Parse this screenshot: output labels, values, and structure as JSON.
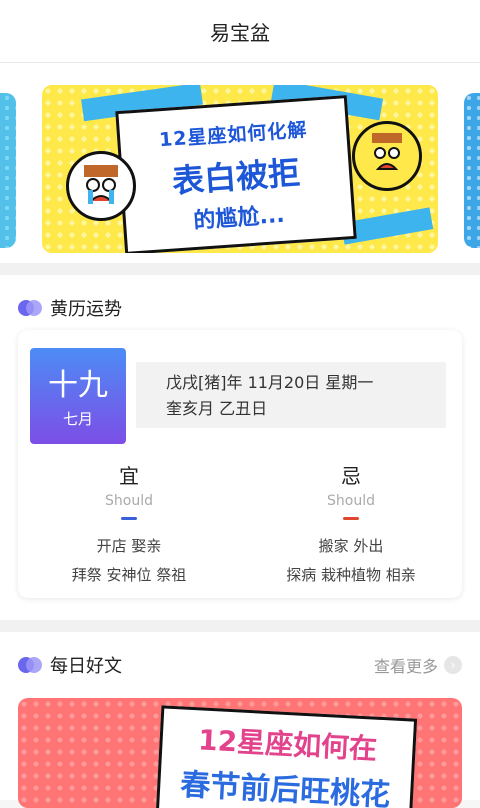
{
  "header": {
    "title": "易宝盆"
  },
  "banner": {
    "line1": "12星座如何化解",
    "line2": "表白被拒",
    "line3": "的尴尬..."
  },
  "almanac": {
    "section_title": "黄历运势",
    "day": "十九",
    "month": "七月",
    "date_line1": "戊戌[猪]年  11月20日  星期一",
    "date_line2": "奎亥月 乙丑日",
    "yi": {
      "title": "宜",
      "sub": "Should",
      "row1": "开店  娶亲",
      "row2": "拜祭  安神位  祭祖",
      "color": "#3a5fd9"
    },
    "ji": {
      "title": "忌",
      "sub": "Should",
      "row1": "搬家  外出",
      "row2": "探病  栽种植物  相亲",
      "color": "#e2452f"
    }
  },
  "articles": {
    "section_title": "每日好文",
    "more_label": "查看更多",
    "banner_line1": "12星座如何在",
    "banner_line2": "春节前后旺桃花"
  },
  "icons": [
    "dot-pair-icon",
    "chevron-right-icon"
  ]
}
